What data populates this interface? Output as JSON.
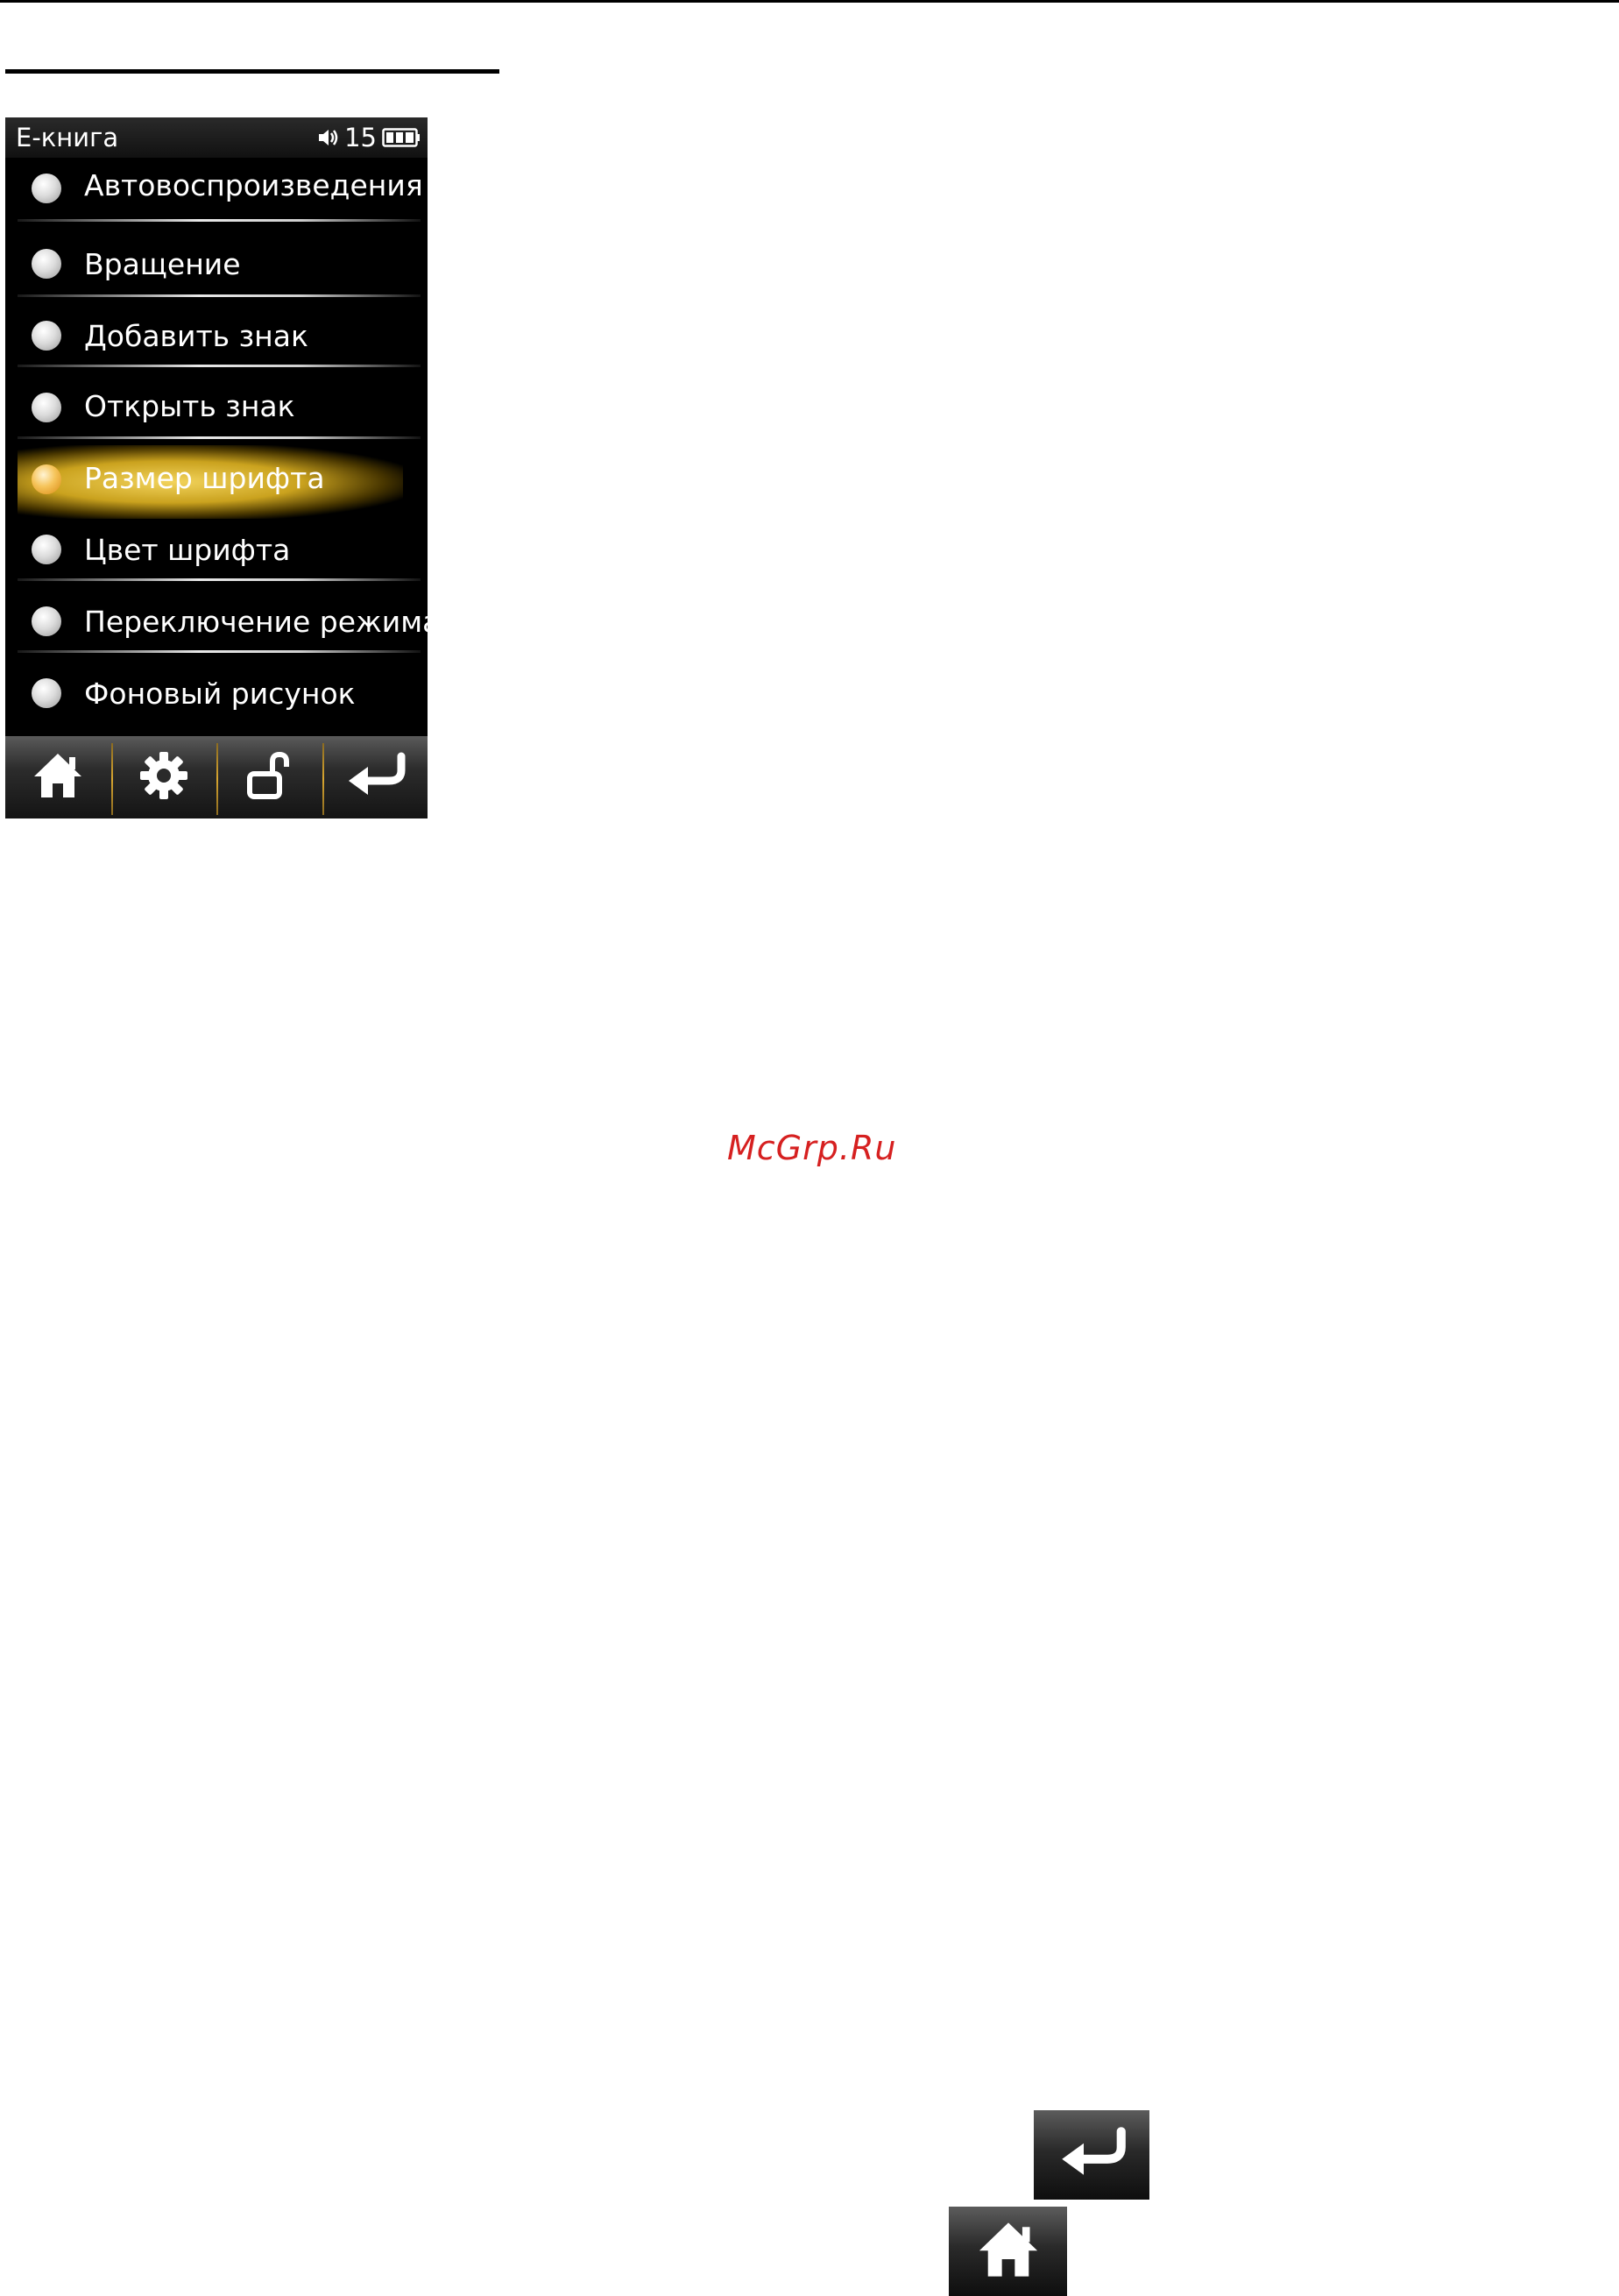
{
  "device": {
    "status_bar": {
      "title": "E-книга",
      "volume": "15"
    },
    "menu": {
      "items": [
        {
          "label": "Автовоспроизведения",
          "selected": false
        },
        {
          "label": "Вращение",
          "selected": false
        },
        {
          "label": "Добавить знак",
          "selected": false
        },
        {
          "label": "Открыть знак",
          "selected": false
        },
        {
          "label": "Размер шрифта",
          "selected": true
        },
        {
          "label": "Цвет шрифта",
          "selected": false
        },
        {
          "label": "Переключение режима",
          "selected": false
        },
        {
          "label": "Фоновый рисунок",
          "selected": false
        }
      ]
    },
    "bottom_bar": {
      "buttons": [
        "home-icon",
        "gear-icon",
        "lock-icon",
        "return-icon"
      ]
    },
    "colors": {
      "highlight": "#e5b628",
      "radio_selected": "#f0a830"
    }
  },
  "watermark": "McGrp.Ru",
  "inline_icons": [
    "return-icon",
    "home-icon"
  ]
}
